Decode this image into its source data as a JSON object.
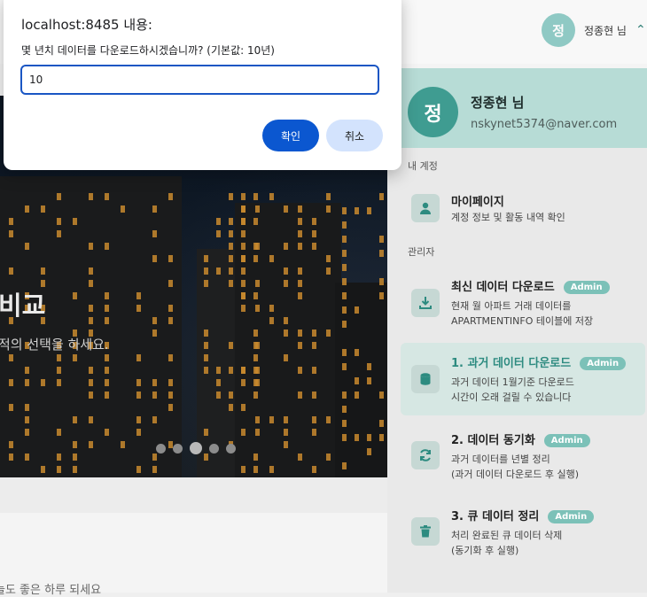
{
  "dialog": {
    "title": "localhost:8485 내용:",
    "message": "몇 년치 데이터를 다운로드하시겠습니까? (기본값: 10년)",
    "input_value": "10",
    "ok_label": "확인",
    "cancel_label": "취소"
  },
  "header": {
    "avatar_initial": "정",
    "user_name": "정종현 님",
    "chevron": "^"
  },
  "hero": {
    "title_partial": "비교",
    "subtitle_partial": "적의 선택을 하세요.",
    "slides": 5,
    "active_slide": 3
  },
  "footer": {
    "greeting_partial": "늘도 좋은 하루 되세요"
  },
  "profile": {
    "avatar_initial": "정",
    "name": "정종현 님",
    "email": "nskynet5374@naver.com"
  },
  "sections": {
    "my_account": "내 계정",
    "admin": "관리자"
  },
  "menu": {
    "mypage": {
      "title": "마이페이지",
      "desc": "계정 정보 및 활동 내역 확인",
      "icon": "person-icon"
    },
    "latest": {
      "title": "최신 데이터 다운로드",
      "badge": "Admin",
      "desc1": "현재 월 아파트 거래 데이터를",
      "desc2": "APARTMENTINFO 테이블에 저장",
      "icon": "download-icon"
    },
    "past": {
      "title": "1. 과거 데이터 다운로드",
      "badge": "Admin",
      "desc1": "과거 데이터 1월기준 다운로드",
      "desc2": "시간이 오래 걸릴 수 있습니다",
      "icon": "database-icon"
    },
    "sync": {
      "title": "2. 데이터 동기화",
      "badge": "Admin",
      "desc1": "과거 데이터를 년별 정리",
      "desc2": "(과거 데이터 다운로드 후 실행)",
      "icon": "sync-icon"
    },
    "cleanup": {
      "title": "3. 큐 데이터 정리",
      "badge": "Admin",
      "desc1": "처리 완료된 큐 데이터 삭제",
      "desc2": "(동기화 후 실행)",
      "icon": "trash-icon"
    }
  },
  "colors": {
    "accent": "#2d8b80",
    "dialog_primary": "#0b57d0",
    "dialog_secondary": "#d3e3fd"
  }
}
